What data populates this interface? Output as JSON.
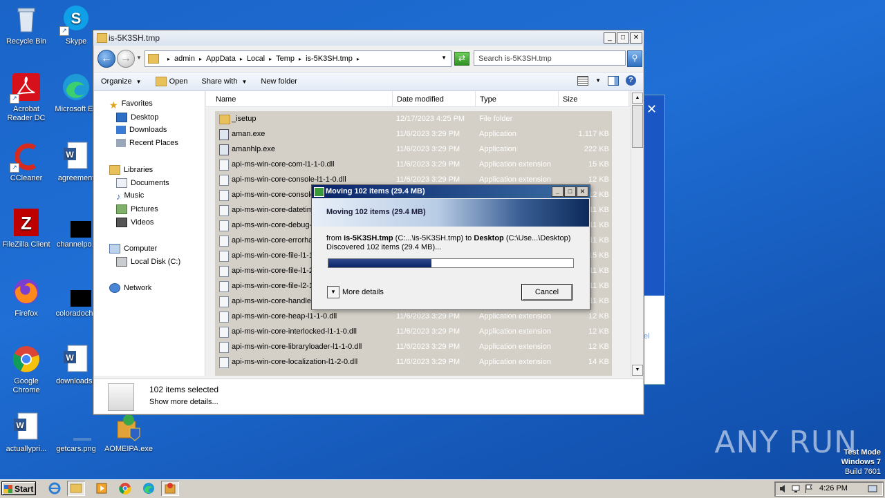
{
  "desktop": {
    "icons": [
      {
        "label": "Recycle Bin"
      },
      {
        "label": "Skype"
      },
      {
        "label": "Acrobat Reader DC"
      },
      {
        "label": "Microsoft Ed"
      },
      {
        "label": "CCleaner"
      },
      {
        "label": "agreement"
      },
      {
        "label": "FileZilla Client"
      },
      {
        "label": "channelpo.j"
      },
      {
        "label": "Firefox"
      },
      {
        "label": "coloradochil"
      },
      {
        "label": "Google Chrome"
      },
      {
        "label": "downloadsc"
      },
      {
        "label": "actuallypri..."
      },
      {
        "label": "getcars.png"
      },
      {
        "label": "AOMEIPA.exe"
      }
    ]
  },
  "explorer": {
    "title": "is-5K3SH.tmp",
    "breadcrumb": [
      "admin",
      "AppData",
      "Local",
      "Temp",
      "is-5K3SH.tmp"
    ],
    "search_placeholder": "Search is-5K3SH.tmp",
    "toolbar": {
      "organize": "Organize",
      "open": "Open",
      "share_with": "Share with",
      "new_folder": "New folder"
    },
    "nav": {
      "favorites": "Favorites",
      "desktop": "Desktop",
      "downloads": "Downloads",
      "recent": "Recent Places",
      "libraries": "Libraries",
      "documents": "Documents",
      "music": "Music",
      "pictures": "Pictures",
      "videos": "Videos",
      "computer": "Computer",
      "localdisk": "Local Disk (C:)",
      "network": "Network"
    },
    "columns": {
      "name": "Name",
      "date": "Date modified",
      "type": "Type",
      "size": "Size"
    },
    "files": [
      {
        "name": "_isetup",
        "date": "12/17/2023 4:25 PM",
        "type": "File folder",
        "size": ""
      },
      {
        "name": "aman.exe",
        "date": "11/6/2023 3:29 PM",
        "type": "Application",
        "size": "1,117 KB"
      },
      {
        "name": "amanhlp.exe",
        "date": "11/6/2023 3:29 PM",
        "type": "Application",
        "size": "222 KB"
      },
      {
        "name": "api-ms-win-core-com-l1-1-0.dll",
        "date": "11/6/2023 3:29 PM",
        "type": "Application extension",
        "size": "15 KB"
      },
      {
        "name": "api-ms-win-core-console-l1-1-0.dll",
        "date": "11/6/2023 3:29 PM",
        "type": "Application extension",
        "size": "12 KB"
      },
      {
        "name": "api-ms-win-core-console",
        "date": "",
        "type": "",
        "size": "12 KB"
      },
      {
        "name": "api-ms-win-core-datetim",
        "date": "",
        "type": "",
        "size": "11 KB"
      },
      {
        "name": "api-ms-win-core-debug-l",
        "date": "",
        "type": "",
        "size": "11 KB"
      },
      {
        "name": "api-ms-win-core-errorha",
        "date": "",
        "type": "",
        "size": "11 KB"
      },
      {
        "name": "api-ms-win-core-file-l1-1",
        "date": "",
        "type": "",
        "size": "15 KB"
      },
      {
        "name": "api-ms-win-core-file-l1-2",
        "date": "",
        "type": "",
        "size": "11 KB"
      },
      {
        "name": "api-ms-win-core-file-l2-1",
        "date": "",
        "type": "",
        "size": "11 KB"
      },
      {
        "name": "api-ms-win-core-handle-",
        "date": "",
        "type": "",
        "size": "11 KB"
      },
      {
        "name": "api-ms-win-core-heap-l1-1-0.dll",
        "date": "11/6/2023 3:29 PM",
        "type": "Application extension",
        "size": "12 KB"
      },
      {
        "name": "api-ms-win-core-interlocked-l1-1-0.dll",
        "date": "11/6/2023 3:29 PM",
        "type": "Application extension",
        "size": "12 KB"
      },
      {
        "name": "api-ms-win-core-libraryloader-l1-1-0.dll",
        "date": "11/6/2023 3:29 PM",
        "type": "Application extension",
        "size": "12 KB"
      },
      {
        "name": "api-ms-win-core-localization-l1-2-0.dll",
        "date": "11/6/2023 3:29 PM",
        "type": "Application extension",
        "size": "14 KB"
      }
    ],
    "details": {
      "count": "102 items selected",
      "more": "Show more details..."
    }
  },
  "copy_dialog": {
    "title": "Moving 102 items (29.4 MB)",
    "banner": "Moving 102 items (29.4 MB)",
    "from_label": "from",
    "from_name": "is-5K3SH.tmp",
    "from_path": "(C:...\\is-5K3SH.tmp)",
    "to_label": "to",
    "to_name": "Desktop",
    "to_path": "(C:\\Use...\\Desktop)",
    "discovered": "Discovered 102 items (29.4 MB)...",
    "progress": 0.42,
    "more_details": "More details",
    "cancel": "Cancel"
  },
  "taskbar": {
    "start": "Start",
    "clock": "4:26 PM"
  },
  "watermark": "ANY  RUN",
  "testmode": {
    "line1": "Test Mode",
    "line2": "Windows 7",
    "line3": "Build 7601"
  }
}
